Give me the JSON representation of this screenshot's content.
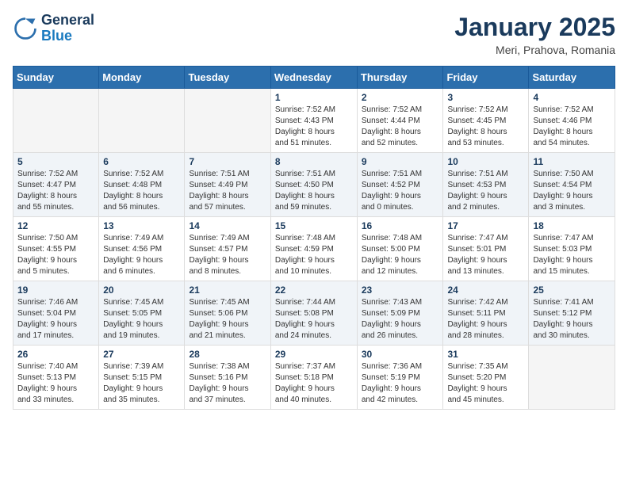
{
  "header": {
    "logo_line1": "General",
    "logo_line2": "Blue",
    "month": "January 2025",
    "location": "Meri, Prahova, Romania"
  },
  "weekdays": [
    "Sunday",
    "Monday",
    "Tuesday",
    "Wednesday",
    "Thursday",
    "Friday",
    "Saturday"
  ],
  "weeks": [
    [
      {
        "day": "",
        "info": ""
      },
      {
        "day": "",
        "info": ""
      },
      {
        "day": "",
        "info": ""
      },
      {
        "day": "1",
        "info": "Sunrise: 7:52 AM\nSunset: 4:43 PM\nDaylight: 8 hours\nand 51 minutes."
      },
      {
        "day": "2",
        "info": "Sunrise: 7:52 AM\nSunset: 4:44 PM\nDaylight: 8 hours\nand 52 minutes."
      },
      {
        "day": "3",
        "info": "Sunrise: 7:52 AM\nSunset: 4:45 PM\nDaylight: 8 hours\nand 53 minutes."
      },
      {
        "day": "4",
        "info": "Sunrise: 7:52 AM\nSunset: 4:46 PM\nDaylight: 8 hours\nand 54 minutes."
      }
    ],
    [
      {
        "day": "5",
        "info": "Sunrise: 7:52 AM\nSunset: 4:47 PM\nDaylight: 8 hours\nand 55 minutes."
      },
      {
        "day": "6",
        "info": "Sunrise: 7:52 AM\nSunset: 4:48 PM\nDaylight: 8 hours\nand 56 minutes."
      },
      {
        "day": "7",
        "info": "Sunrise: 7:51 AM\nSunset: 4:49 PM\nDaylight: 8 hours\nand 57 minutes."
      },
      {
        "day": "8",
        "info": "Sunrise: 7:51 AM\nSunset: 4:50 PM\nDaylight: 8 hours\nand 59 minutes."
      },
      {
        "day": "9",
        "info": "Sunrise: 7:51 AM\nSunset: 4:52 PM\nDaylight: 9 hours\nand 0 minutes."
      },
      {
        "day": "10",
        "info": "Sunrise: 7:51 AM\nSunset: 4:53 PM\nDaylight: 9 hours\nand 2 minutes."
      },
      {
        "day": "11",
        "info": "Sunrise: 7:50 AM\nSunset: 4:54 PM\nDaylight: 9 hours\nand 3 minutes."
      }
    ],
    [
      {
        "day": "12",
        "info": "Sunrise: 7:50 AM\nSunset: 4:55 PM\nDaylight: 9 hours\nand 5 minutes."
      },
      {
        "day": "13",
        "info": "Sunrise: 7:49 AM\nSunset: 4:56 PM\nDaylight: 9 hours\nand 6 minutes."
      },
      {
        "day": "14",
        "info": "Sunrise: 7:49 AM\nSunset: 4:57 PM\nDaylight: 9 hours\nand 8 minutes."
      },
      {
        "day": "15",
        "info": "Sunrise: 7:48 AM\nSunset: 4:59 PM\nDaylight: 9 hours\nand 10 minutes."
      },
      {
        "day": "16",
        "info": "Sunrise: 7:48 AM\nSunset: 5:00 PM\nDaylight: 9 hours\nand 12 minutes."
      },
      {
        "day": "17",
        "info": "Sunrise: 7:47 AM\nSunset: 5:01 PM\nDaylight: 9 hours\nand 13 minutes."
      },
      {
        "day": "18",
        "info": "Sunrise: 7:47 AM\nSunset: 5:03 PM\nDaylight: 9 hours\nand 15 minutes."
      }
    ],
    [
      {
        "day": "19",
        "info": "Sunrise: 7:46 AM\nSunset: 5:04 PM\nDaylight: 9 hours\nand 17 minutes."
      },
      {
        "day": "20",
        "info": "Sunrise: 7:45 AM\nSunset: 5:05 PM\nDaylight: 9 hours\nand 19 minutes."
      },
      {
        "day": "21",
        "info": "Sunrise: 7:45 AM\nSunset: 5:06 PM\nDaylight: 9 hours\nand 21 minutes."
      },
      {
        "day": "22",
        "info": "Sunrise: 7:44 AM\nSunset: 5:08 PM\nDaylight: 9 hours\nand 24 minutes."
      },
      {
        "day": "23",
        "info": "Sunrise: 7:43 AM\nSunset: 5:09 PM\nDaylight: 9 hours\nand 26 minutes."
      },
      {
        "day": "24",
        "info": "Sunrise: 7:42 AM\nSunset: 5:11 PM\nDaylight: 9 hours\nand 28 minutes."
      },
      {
        "day": "25",
        "info": "Sunrise: 7:41 AM\nSunset: 5:12 PM\nDaylight: 9 hours\nand 30 minutes."
      }
    ],
    [
      {
        "day": "26",
        "info": "Sunrise: 7:40 AM\nSunset: 5:13 PM\nDaylight: 9 hours\nand 33 minutes."
      },
      {
        "day": "27",
        "info": "Sunrise: 7:39 AM\nSunset: 5:15 PM\nDaylight: 9 hours\nand 35 minutes."
      },
      {
        "day": "28",
        "info": "Sunrise: 7:38 AM\nSunset: 5:16 PM\nDaylight: 9 hours\nand 37 minutes."
      },
      {
        "day": "29",
        "info": "Sunrise: 7:37 AM\nSunset: 5:18 PM\nDaylight: 9 hours\nand 40 minutes."
      },
      {
        "day": "30",
        "info": "Sunrise: 7:36 AM\nSunset: 5:19 PM\nDaylight: 9 hours\nand 42 minutes."
      },
      {
        "day": "31",
        "info": "Sunrise: 7:35 AM\nSunset: 5:20 PM\nDaylight: 9 hours\nand 45 minutes."
      },
      {
        "day": "",
        "info": ""
      }
    ]
  ]
}
